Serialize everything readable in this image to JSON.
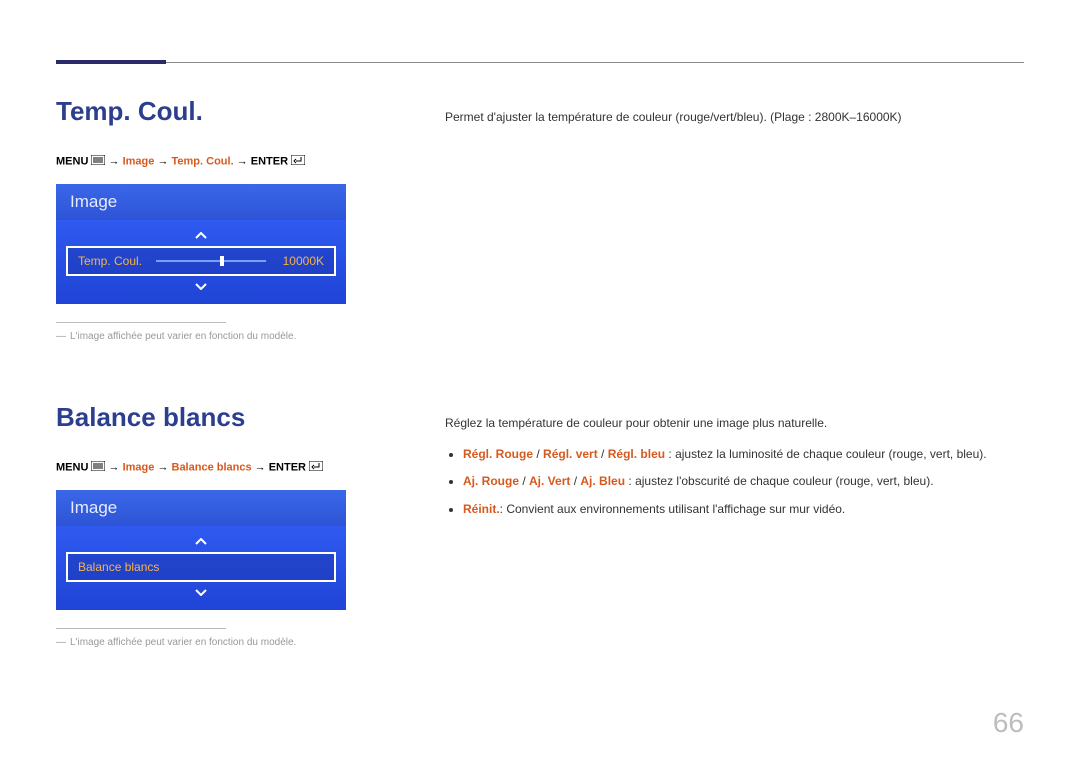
{
  "page_number": "66",
  "section1": {
    "title": "Temp. Coul.",
    "menu_path": {
      "prefix": "MENU ",
      "p1": " → ",
      "p2": "Image",
      "p3": " → ",
      "p4": "Temp. Coul.",
      "p5": " → ",
      "p6": "ENTER "
    },
    "osd": {
      "header": "Image",
      "row_label": "Temp. Coul.",
      "row_value": "10000K"
    },
    "footnote": "L'image affichée peut varier en fonction du modèle.",
    "right_text": "Permet d'ajuster la température de couleur (rouge/vert/bleu). (Plage : 2800K–16000K)"
  },
  "section2": {
    "title": "Balance blancs",
    "menu_path": {
      "prefix": "MENU ",
      "p1": " → ",
      "p2": "Image",
      "p3": " → ",
      "p4": "Balance blancs",
      "p5": " → ",
      "p6": "ENTER "
    },
    "osd": {
      "header": "Image",
      "row_label": "Balance blancs"
    },
    "footnote": "L'image affichée peut varier en fonction du modèle.",
    "right_intro": "Réglez la température de couleur pour obtenir une image plus naturelle.",
    "bullets": [
      {
        "lead_parts": [
          "Régl. Rouge",
          " / ",
          "Régl. vert",
          " / ",
          "Régl. bleu"
        ],
        "rest": " : ajustez la luminosité de chaque couleur (rouge, vert, bleu)."
      },
      {
        "lead_parts": [
          "Aj. Rouge",
          " / ",
          "Aj. Vert",
          " / ",
          "Aj. Bleu"
        ],
        "rest": " : ajustez l'obscurité de chaque couleur (rouge, vert, bleu)."
      },
      {
        "lead_parts": [
          "Réinit."
        ],
        "rest": ": Convient aux environnements utilisant l'affichage sur mur vidéo."
      }
    ]
  }
}
